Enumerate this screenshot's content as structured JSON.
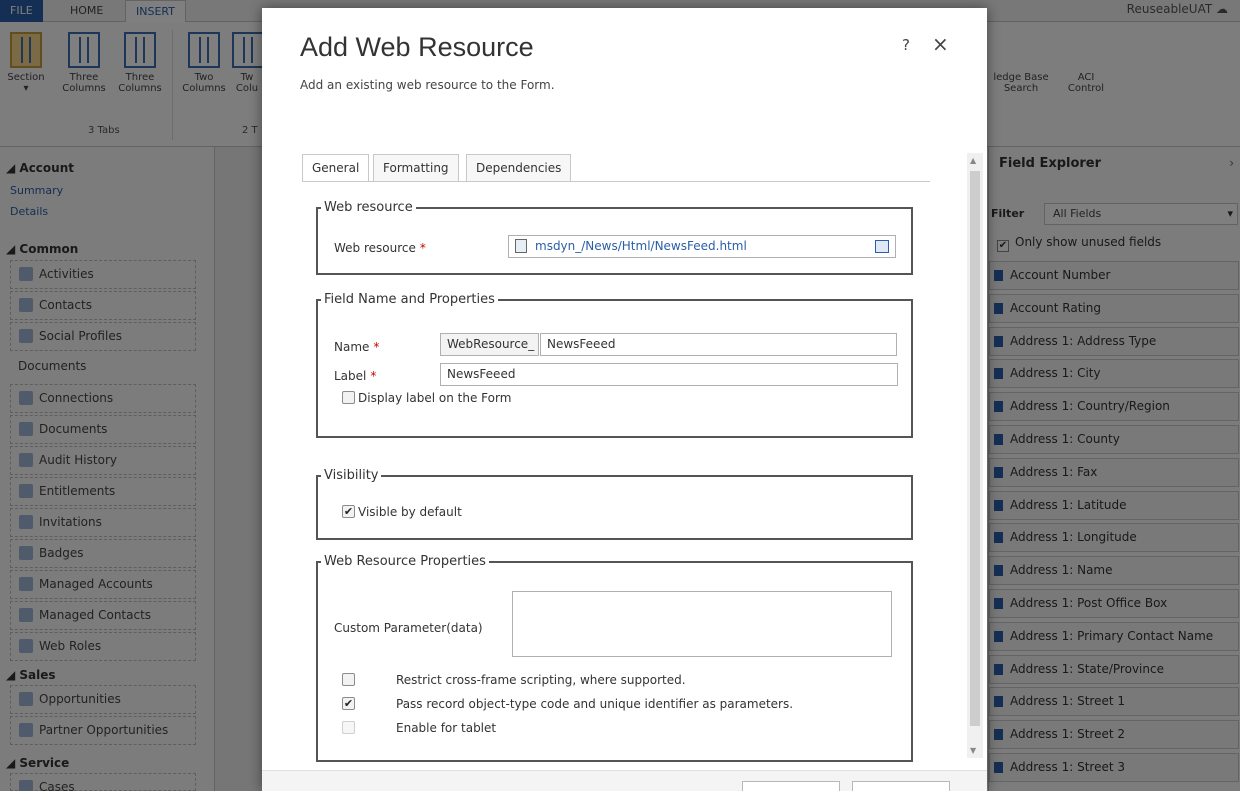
{
  "ribbon": {
    "tabs": [
      "FILE",
      "HOME",
      "INSERT"
    ],
    "user": "ReuseableUAT",
    "buttons": [
      {
        "label": "Section"
      },
      {
        "label": "Three Columns"
      },
      {
        "label": "Three Columns"
      },
      {
        "label": "Two Columns"
      },
      {
        "label": "Tw Colu"
      }
    ],
    "right_buttons": [
      {
        "label": "ledge Base Search"
      },
      {
        "label": "ACI Control"
      }
    ],
    "groups": [
      "3 Tabs",
      "2 T"
    ]
  },
  "nav": {
    "entity": "Account",
    "entity_links": [
      "Summary",
      "Details"
    ],
    "sections": [
      {
        "title": "Common",
        "items": [
          "Activities",
          "Contacts",
          "Social Profiles",
          "Documents",
          "Connections",
          "Documents",
          "Audit History",
          "Entitlements",
          "Invitations",
          "Badges",
          "Managed Accounts",
          "Managed Contacts",
          "Web Roles"
        ]
      },
      {
        "title": "Sales",
        "items": [
          "Opportunities",
          "Partner Opportunities"
        ]
      },
      {
        "title": "Service",
        "items": [
          "Cases"
        ]
      }
    ]
  },
  "field_explorer": {
    "title": "Field Explorer",
    "filter_label": "Filter",
    "filter_value": "All Fields",
    "only_unused_label": "Only show unused fields",
    "only_unused_checked": true,
    "fields": [
      "Account Number",
      "Account Rating",
      "Address 1: Address Type",
      "Address 1: City",
      "Address 1: Country/Region",
      "Address 1: County",
      "Address 1: Fax",
      "Address 1: Latitude",
      "Address 1: Longitude",
      "Address 1: Name",
      "Address 1: Post Office Box",
      "Address 1: Primary Contact Name",
      "Address 1: State/Province",
      "Address 1: Street 1",
      "Address 1: Street 2",
      "Address 1: Street 3"
    ]
  },
  "dialog": {
    "title": "Add Web Resource",
    "subtitle": "Add an existing web resource to the Form.",
    "help": "?",
    "close": "×",
    "tabs": [
      "General",
      "Formatting",
      "Dependencies"
    ],
    "web_resource_group": {
      "legend": "Web resource",
      "label": "Web resource",
      "required_mark": "*",
      "value": "msdyn_/News/Html/NewsFeed.html"
    },
    "field_group": {
      "legend": "Field Name and Properties",
      "name_label": "Name",
      "name_prefix": "WebResource_",
      "name_value": "NewsFeeed",
      "label_label": "Label",
      "label_value": "NewsFeeed",
      "display_label_text": "Display label on the Form",
      "display_label_checked": false
    },
    "visibility_group": {
      "legend": "Visibility",
      "visible_text": "Visible by default",
      "visible_checked": true
    },
    "properties_group": {
      "legend": "Web Resource Properties",
      "custom_param_label": "Custom Parameter(data)",
      "custom_param_value": "",
      "options": [
        {
          "text": "Restrict cross-frame scripting, where supported.",
          "checked": false,
          "disabled": false
        },
        {
          "text": "Pass record object-type code and unique identifier as parameters.",
          "checked": true,
          "disabled": false
        },
        {
          "text": "Enable for tablet",
          "checked": false,
          "disabled": true
        }
      ]
    }
  }
}
